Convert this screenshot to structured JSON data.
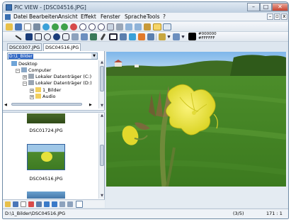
{
  "window": {
    "title": "PIC VIEW - [DSC04516.JPG]",
    "controls": {
      "minimize": "–",
      "maximize": "□",
      "close": "✕"
    }
  },
  "menu": {
    "items": [
      {
        "label": "Datei"
      },
      {
        "label": "Bearbeiten"
      },
      {
        "label": "Ansicht"
      },
      {
        "label": "Effekt"
      },
      {
        "label": "Fenster"
      },
      {
        "label": "Sprache"
      },
      {
        "label": "Tools"
      },
      {
        "label": "?"
      }
    ],
    "mdi_controls": {
      "minimize": "–",
      "restore": "▫",
      "close": "x"
    }
  },
  "toolbar": {
    "fg_color_hex": "#000000",
    "bg_color_hex": "#FFFFFF"
  },
  "tabs": [
    {
      "label": "DSC0307.JPG",
      "active": false
    },
    {
      "label": "DSC04516.JPG",
      "active": true
    }
  ],
  "sidebar": {
    "path_value": "D:\\1_Bilder",
    "tree": [
      {
        "label": "Desktop",
        "icon": "desktop-icon"
      },
      {
        "label": "Computer",
        "icon": "computer-icon"
      },
      {
        "label": "Lokaler Datenträger (C:)",
        "icon": "drive-icon"
      },
      {
        "label": "Lokaler Datenträger (D:)",
        "icon": "drive-icon"
      },
      {
        "label": "1_Bilder",
        "icon": "folder-icon"
      },
      {
        "label": "Audio",
        "icon": "folder-icon"
      }
    ],
    "thumbnails": [
      {
        "label": "DSC01724.JPG"
      },
      {
        "label": "DSC04516.JPG"
      }
    ]
  },
  "status": {
    "path": "D:\\1_Bilder\\DSC04516.JPG",
    "position": "(3/5)",
    "zoom": "171 : 1"
  },
  "colors": {
    "accent": "#3168c5",
    "window_border": "#6f8ba6"
  }
}
